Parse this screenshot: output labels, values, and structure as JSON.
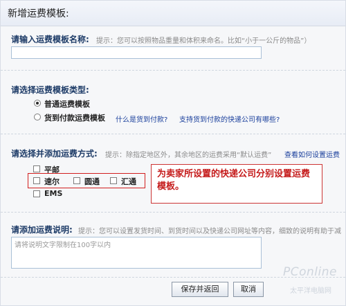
{
  "header": {
    "title": "新增运费模板:"
  },
  "name_section": {
    "label": "请输入运费模板名称:",
    "hint": "提示：您可以按照物品重量和体积来命名。比如“小于一公斤的物品”）",
    "value": ""
  },
  "type_section": {
    "label": "请选择运费模板类型:",
    "options": [
      {
        "label": "普通运费模板",
        "selected": true
      },
      {
        "label": "货到付款运费模板",
        "selected": false
      }
    ],
    "links": [
      "什么是货到付款?",
      "支持货到付款的快递公司有哪些?"
    ]
  },
  "method_section": {
    "label": "请选择并添加运费方式:",
    "hint": "提示：除指定地区外，其余地区的运费采用“默认运费”",
    "link": "查看如何设置运费",
    "carriers": [
      "平邮",
      "速尔",
      "圆通",
      "汇通",
      "EMS"
    ]
  },
  "callout": {
    "text": "为卖家所设置的快递公司分别设置运费模板。",
    "color": "#c51b1b"
  },
  "note_section": {
    "label": "请添加运费说明:",
    "hint": "提示：您可以设置发货时间、到货时间以及快递公司网址等内容，细致的说明有助于减",
    "placeholder": "请将说明文字限制在100字以内"
  },
  "buttons": {
    "save": "保存并返回",
    "cancel": "取消"
  },
  "watermark": {
    "brand": "PConline",
    "caption": "太平洋电脑网"
  }
}
